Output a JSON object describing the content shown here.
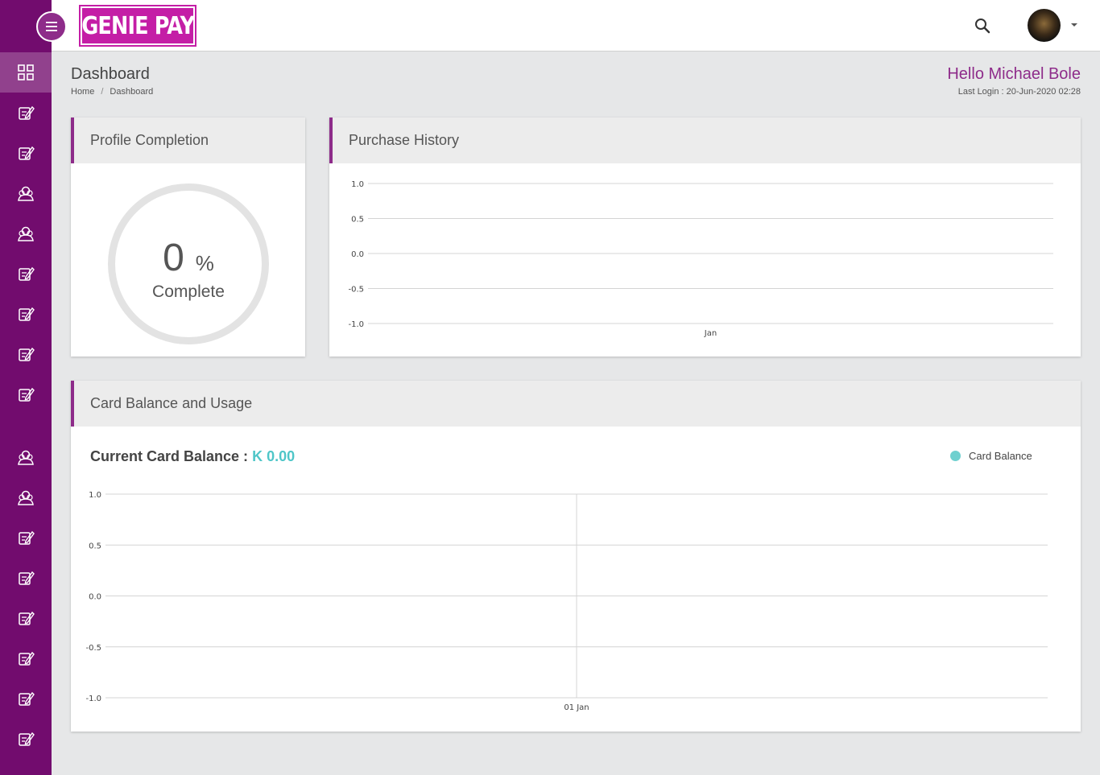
{
  "brand": {
    "logo_text": "GENIE PAY",
    "accent": "#720c6e",
    "logo_color": "#c41ea6"
  },
  "sidebar": {
    "icons": [
      "dashboard-icon",
      "edit-icon",
      "edit-icon",
      "users-icon",
      "users-icon",
      "edit-icon",
      "edit-icon",
      "edit-icon",
      "edit-icon",
      "users-icon",
      "users-icon",
      "edit-icon",
      "edit-icon",
      "edit-icon",
      "edit-icon",
      "edit-icon",
      "edit-icon"
    ]
  },
  "page": {
    "title": "Dashboard",
    "breadcrumb": {
      "home": "Home",
      "separator": "/",
      "current": "Dashboard"
    },
    "greeting": "Hello Michael Bole",
    "last_login": "Last Login : 20-Jun-2020 02:28"
  },
  "profile": {
    "title": "Profile Completion",
    "percent": "0",
    "percent_symbol": "%",
    "label": "Complete"
  },
  "purchase_history": {
    "title": "Purchase History"
  },
  "card_balance": {
    "title": "Card Balance and Usage",
    "label": "Current Card Balance :",
    "value": "K 0.00",
    "value_color": "#4fc6c8",
    "legend_color": "#6fd0cf"
  },
  "chart_data": [
    {
      "type": "line",
      "title": "Purchase History",
      "categories": [
        "Jan"
      ],
      "series": [],
      "y_ticks": [
        "1.0",
        "0.5",
        "0.0",
        "-0.5",
        "-1.0"
      ],
      "ylim": [
        -1.0,
        1.0
      ],
      "grid": true
    },
    {
      "type": "line",
      "title": "Card Balance and Usage",
      "categories": [
        "01 Jan"
      ],
      "series": [
        {
          "name": "Card Balance",
          "values": []
        }
      ],
      "y_ticks": [
        "1.0",
        "0.5",
        "0.0",
        "-0.5",
        "-1.0"
      ],
      "ylim": [
        -1.0,
        1.0
      ],
      "grid": true,
      "legend": "top-right"
    }
  ]
}
